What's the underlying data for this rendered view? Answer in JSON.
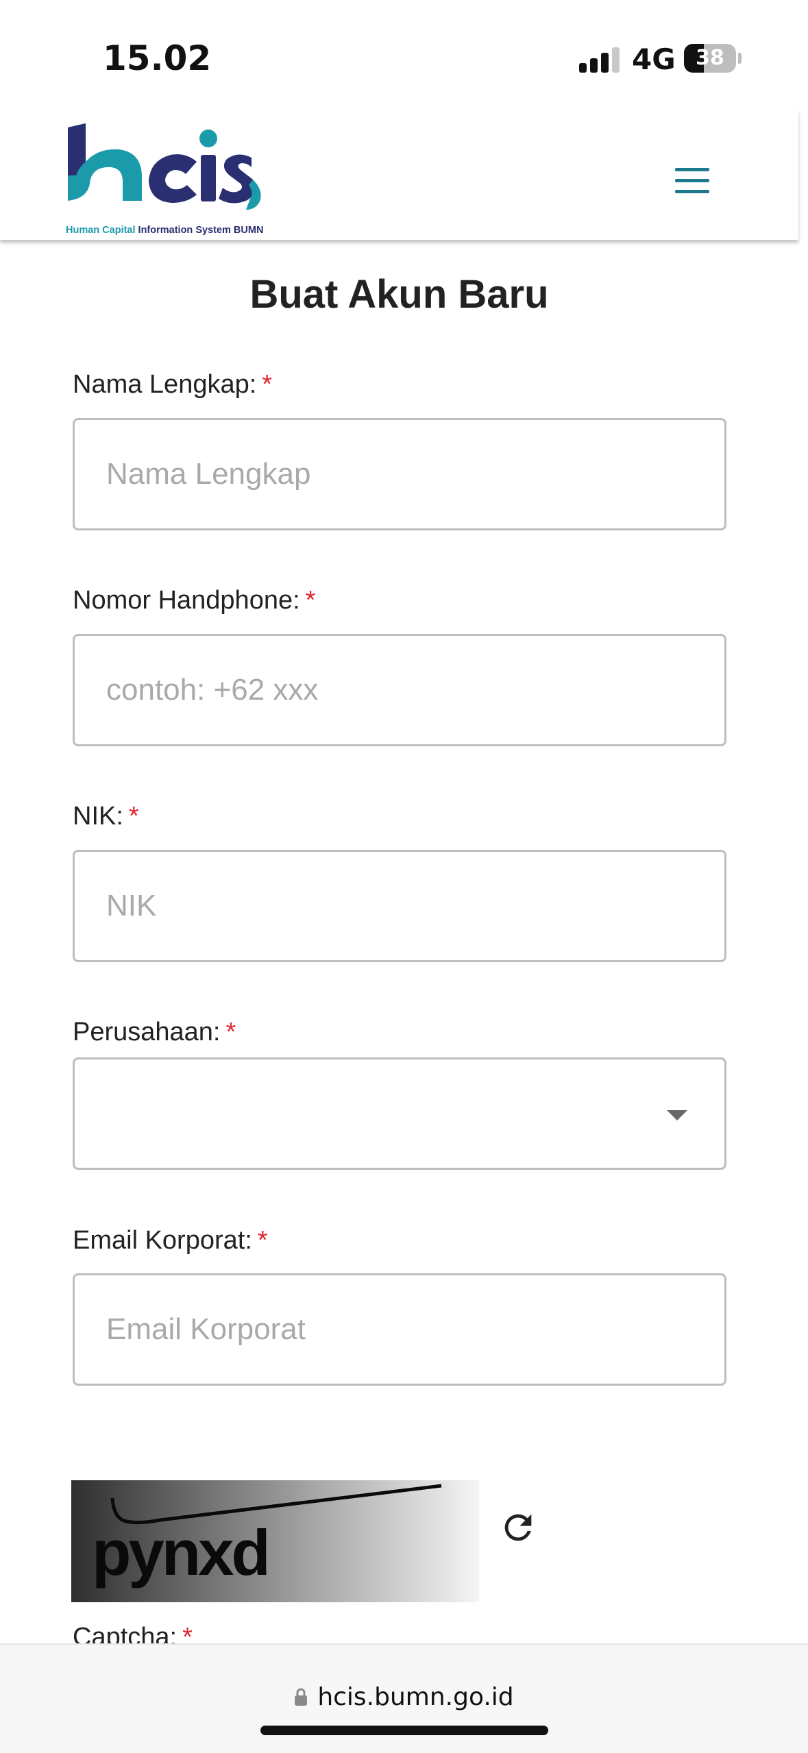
{
  "status_bar": {
    "time": "15.02",
    "network": "4G",
    "battery": "38",
    "battery_level": 0.38
  },
  "header": {
    "logo_text": "hcis",
    "logo_subtitle_part1": "Human Capital",
    "logo_subtitle_part2": "Information System BUMN",
    "menu_icon": "hamburger-icon",
    "colors": {
      "brand_teal": "#1b9aaa",
      "brand_navy": "#2a2f72",
      "menu": "#1c7a8c"
    }
  },
  "form": {
    "title": "Buat Akun Baru",
    "required_mark": "*",
    "fields": {
      "nama": {
        "label": "Nama Lengkap:",
        "placeholder": "Nama Lengkap",
        "value": ""
      },
      "phone": {
        "label": "Nomor Handphone:",
        "placeholder": "contoh: +62 xxx",
        "value": ""
      },
      "nik": {
        "label": "NIK:",
        "placeholder": "NIK",
        "value": ""
      },
      "perusahaan": {
        "label": "Perusahaan:",
        "selected": ""
      },
      "email": {
        "label": "Email Korporat:",
        "placeholder": "Email Korporat",
        "value": ""
      }
    },
    "captcha": {
      "image_text": "pynxd",
      "refresh_icon": "refresh-icon",
      "label": "Captcha:"
    }
  },
  "browser": {
    "url": "hcis.bumn.go.id",
    "lock_icon": "lock-icon"
  }
}
